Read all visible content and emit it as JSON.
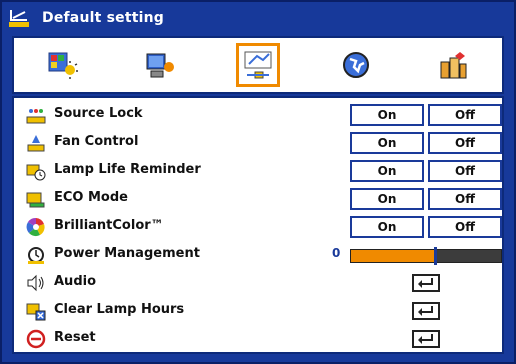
{
  "title": "Default setting",
  "tabs": [
    {
      "name": "image",
      "icon": "image-settings-icon",
      "active": false
    },
    {
      "name": "display",
      "icon": "display-settings-icon",
      "active": false
    },
    {
      "name": "setting",
      "icon": "setting-wrench-icon",
      "active": true
    },
    {
      "name": "options",
      "icon": "globe-options-icon",
      "active": false
    },
    {
      "name": "advanced",
      "icon": "building-advanced-icon",
      "active": false
    }
  ],
  "items": {
    "source_lock": {
      "label": "Source Lock",
      "on": "On",
      "off": "Off",
      "icon": "source-lock-icon"
    },
    "fan_control": {
      "label": "Fan Control",
      "on": "On",
      "off": "Off",
      "icon": "fan-control-icon"
    },
    "lamp_life_reminder": {
      "label": "Lamp Life Reminder",
      "on": "On",
      "off": "Off",
      "icon": "lamp-reminder-icon"
    },
    "eco_mode": {
      "label": "ECO Mode",
      "on": "On",
      "off": "Off",
      "icon": "eco-mode-icon"
    },
    "brilliantcolor": {
      "label": "BrilliantColor™",
      "on": "On",
      "off": "Off",
      "icon": "color-wheel-icon"
    },
    "power_management": {
      "label": "Power Management",
      "value": "0",
      "level": 0.55,
      "icon": "power-management-icon"
    },
    "audio": {
      "label": "Audio",
      "icon": "speaker-icon"
    },
    "clear_lamp_hours": {
      "label": "Clear Lamp Hours",
      "icon": "clear-lamp-icon"
    },
    "reset": {
      "label": "Reset",
      "icon": "reset-icon"
    }
  },
  "colors": {
    "frame": "#17399a",
    "accent": "#f08a00",
    "button_border": "#1a3a9a"
  }
}
